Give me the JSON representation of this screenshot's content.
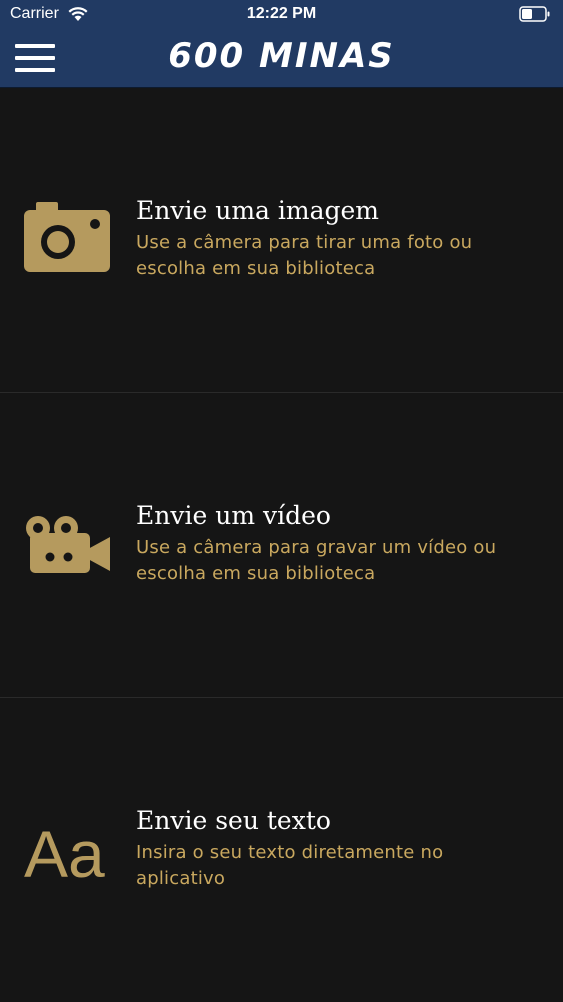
{
  "status_bar": {
    "carrier": "Carrier",
    "time": "12:22 PM",
    "wifi_icon": "wifi-icon",
    "battery_icon": "battery-icon"
  },
  "nav": {
    "menu_icon": "hamburger-menu-icon",
    "title": "600 MINAS"
  },
  "options": [
    {
      "icon": "camera-icon",
      "title": "Envie uma imagem",
      "subtitle": "Use a câmera para tirar uma foto ou escolha em sua biblioteca"
    },
    {
      "icon": "video-camera-icon",
      "title": "Envie um vídeo",
      "subtitle": "Use a câmera para gravar um vídeo ou escolha em sua biblioteca"
    },
    {
      "icon": "text-aa-icon",
      "icon_text": "Aa",
      "title": "Envie seu texto",
      "subtitle": "Insira o seu texto diretamente no aplicativo"
    }
  ],
  "colors": {
    "navbar": "#213a63",
    "background": "#151515",
    "accent": "#c9a85f",
    "icon": "#b59a5e"
  }
}
